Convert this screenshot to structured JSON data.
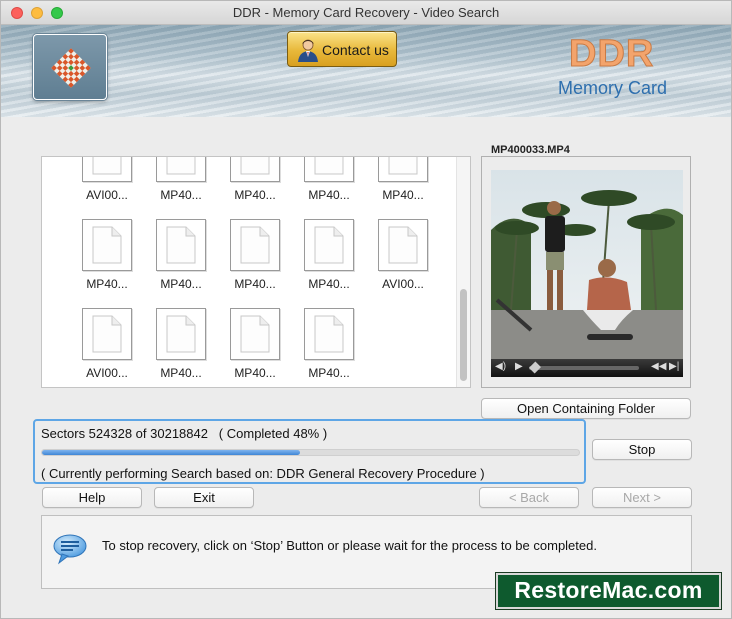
{
  "window": {
    "title": "DDR - Memory Card Recovery - Video Search"
  },
  "banner": {
    "contact_label": "Contact us",
    "brand_title": "DDR",
    "brand_subtitle": "Memory Card"
  },
  "files": [
    {
      "name": "AVI00..."
    },
    {
      "name": "MP40..."
    },
    {
      "name": "MP40..."
    },
    {
      "name": "MP40..."
    },
    {
      "name": "MP40..."
    },
    {
      "name": "MP40..."
    },
    {
      "name": "MP40..."
    },
    {
      "name": "MP40..."
    },
    {
      "name": "MP40..."
    },
    {
      "name": "AVI00..."
    },
    {
      "name": "AVI00..."
    },
    {
      "name": "MP40..."
    },
    {
      "name": "MP40..."
    },
    {
      "name": "MP40..."
    }
  ],
  "preview": {
    "filename": "MP400033.MP4"
  },
  "buttons": {
    "open_folder": "Open Containing Folder",
    "stop": "Stop",
    "help": "Help",
    "exit": "Exit",
    "back": "< Back",
    "next": "Next >"
  },
  "progress": {
    "sectors_text": "Sectors 524328 of 30218842   ( Completed 48% )",
    "percent": 48,
    "status_text": "( Currently performing Search based on: DDR General Recovery Procedure )"
  },
  "info": {
    "message": "To stop recovery, click on ‘Stop’ Button or please wait for the process to be completed."
  },
  "watermark": {
    "text": "RestoreMac.com"
  },
  "colors": {
    "accent": "#5ea6e6",
    "progress": "#3f86d6",
    "watermark_bg": "#0e5a2e"
  }
}
